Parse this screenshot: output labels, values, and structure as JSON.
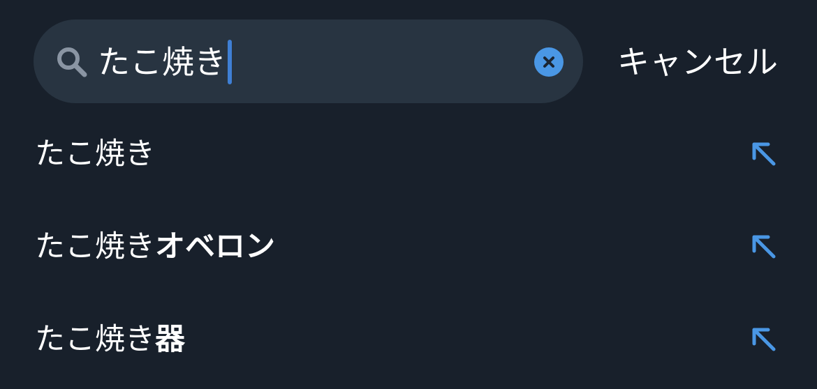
{
  "search": {
    "query": "たこ焼き",
    "icon": "search-icon",
    "clear_icon": "clear-icon"
  },
  "cancel_label": "キャンセル",
  "suggestions": [
    {
      "prefix": "たこ焼き",
      "suffix": ""
    },
    {
      "prefix": "たこ焼き",
      "suffix": "オベロン"
    },
    {
      "prefix": "たこ焼き",
      "suffix": "器"
    }
  ],
  "colors": {
    "background": "#18202b",
    "search_field": "#283441",
    "accent": "#4a97e5",
    "text": "#ffffff"
  }
}
